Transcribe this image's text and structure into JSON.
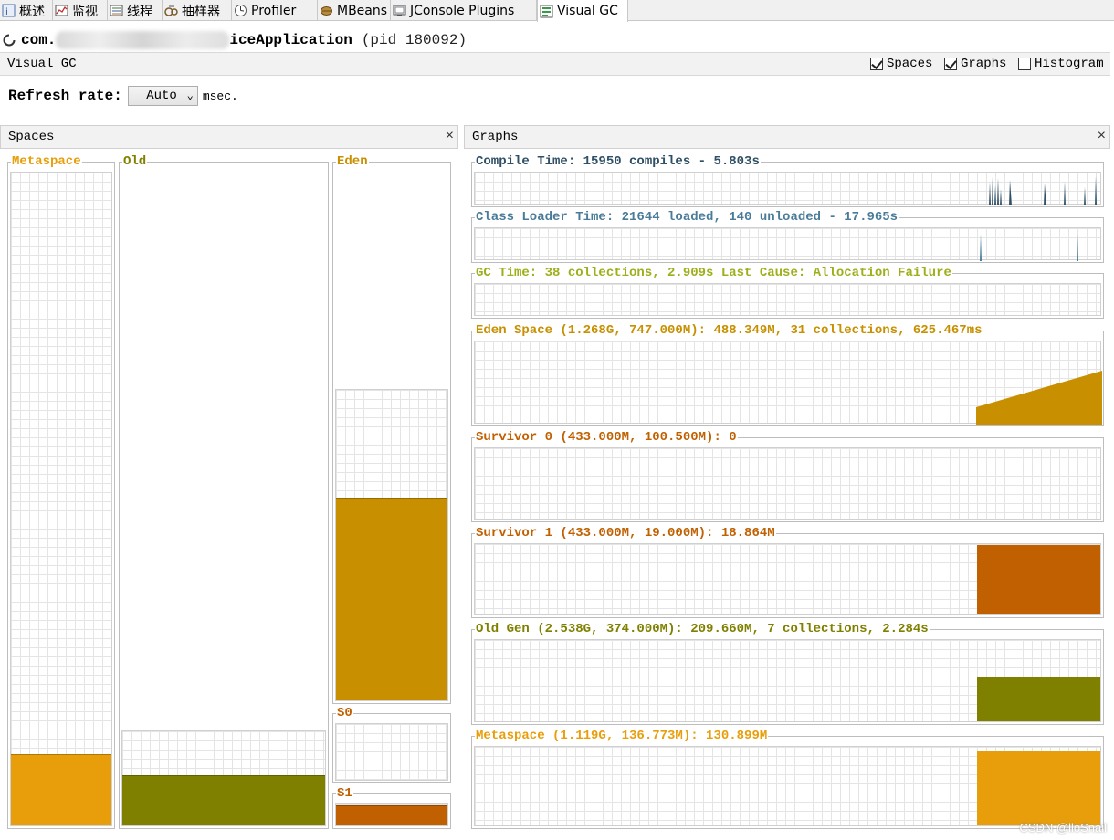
{
  "tabs": [
    {
      "label": "概述",
      "icon": "overview-icon"
    },
    {
      "label": "监视",
      "icon": "monitor-icon"
    },
    {
      "label": "线程",
      "icon": "threads-icon"
    },
    {
      "label": "抽样器",
      "icon": "sampler-icon"
    },
    {
      "label": "Profiler",
      "icon": "profiler-icon"
    },
    {
      "label": "MBeans",
      "icon": "mbeans-icon"
    },
    {
      "label": "JConsole Plugins",
      "icon": "jconsole-icon"
    },
    {
      "label": "Visual GC",
      "icon": "visualgc-icon"
    }
  ],
  "app": {
    "name_prefix": "com.",
    "name_suffix": "iceApplication",
    "pid": "(pid 180092)"
  },
  "visualgc_bar": {
    "title": "Visual GC",
    "spaces_label": "Spaces",
    "graphs_label": "Graphs",
    "histogram_label": "Histogram",
    "spaces_checked": true,
    "graphs_checked": true,
    "histogram_checked": false
  },
  "refresh": {
    "label": "Refresh rate:",
    "value": "Auto",
    "unit": "msec."
  },
  "spaces_panel": {
    "title": "Spaces",
    "close": "×",
    "metaspace": {
      "label": "Metaspace",
      "color": "#E89E0B",
      "used_fraction": 0.109
    },
    "old": {
      "label": "Old",
      "color": "#808000",
      "capacity_fraction": 0.147,
      "used_fraction": 0.078
    },
    "eden": {
      "label": "Eden",
      "color": "#C89000",
      "capacity_fraction": 0.589,
      "used_fraction": 0.385
    },
    "s0": {
      "label": "S0",
      "color": "#C06000",
      "used_fraction": 0.0
    },
    "s1": {
      "label": "S1",
      "color": "#C06000",
      "used_fraction": 0.95
    }
  },
  "graphs_panel": {
    "title": "Graphs",
    "close": "×",
    "compile": {
      "label": "Compile Time: 15950 compiles - 5.803s",
      "color": "#2F4F66"
    },
    "classloader": {
      "label": "Class Loader Time: 21644 loaded, 140 unloaded - 17.965s",
      "color": "#4A7C9A"
    },
    "gctime": {
      "label": "GC Time: 38 collections, 2.909s  Last Cause: Allocation Failure",
      "color": "#9DAF1A"
    },
    "eden": {
      "label": "Eden Space (1.268G, 747.000M): 488.349M, 31 collections, 625.467ms",
      "color": "#C89000"
    },
    "survivor0": {
      "label": "Survivor 0 (433.000M, 100.500M): 0",
      "color": "#C06000"
    },
    "survivor1": {
      "label": "Survivor 1 (433.000M, 19.000M): 18.864M",
      "color": "#C06000"
    },
    "oldgen": {
      "label": "Old Gen (2.538G, 374.000M): 209.660M, 7 collections, 2.284s",
      "color": "#808000"
    },
    "metaspace": {
      "label": "Metaspace (1.119G, 136.773M): 130.899M",
      "color": "#E89E0B"
    }
  },
  "watermark": "CSDN @lloSnail"
}
